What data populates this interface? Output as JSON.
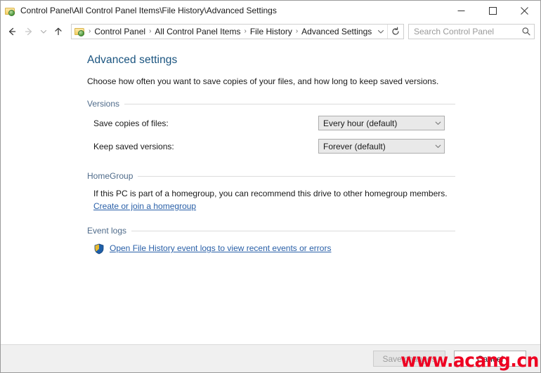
{
  "window": {
    "title": "Control Panel\\All Control Panel Items\\File History\\Advanced Settings",
    "icon": "control-panel-icon",
    "controls": {
      "minimize": "minimize-icon",
      "maximize": "maximize-icon",
      "close": "close-icon"
    }
  },
  "navbar": {
    "back": "back-arrow-icon",
    "forward": "forward-arrow-icon",
    "recent": "recent-locations-chevron-icon",
    "up": "up-arrow-icon",
    "address_icon": "control-panel-icon",
    "breadcrumbs": [
      {
        "label": "Control Panel"
      },
      {
        "label": "All Control Panel Items"
      },
      {
        "label": "File History"
      },
      {
        "label": "Advanced Settings"
      }
    ],
    "separator": "›",
    "dropdown_icon": "chevron-down-icon",
    "refresh_icon": "refresh-icon",
    "search": {
      "placeholder": "Search Control Panel",
      "value": "",
      "icon": "search-icon"
    }
  },
  "main": {
    "title": "Advanced settings",
    "description": "Choose how often you want to save copies of your files, and how long to keep saved versions.",
    "sections": {
      "versions": {
        "header": "Versions",
        "rows": [
          {
            "label": "Save copies of files:",
            "value": "Every hour (default)",
            "arrow_icon": "chevron-down-icon"
          },
          {
            "label": "Keep saved versions:",
            "value": "Forever (default)",
            "arrow_icon": "chevron-down-icon"
          }
        ]
      },
      "homegroup": {
        "header": "HomeGroup",
        "text": "If this PC is part of a homegroup, you can recommend this drive to other homegroup members.",
        "link": "Create or join a homegroup"
      },
      "event_logs": {
        "header": "Event logs",
        "shield_icon": "uac-shield-icon",
        "link": "Open File History event logs to view recent events or errors"
      }
    }
  },
  "footer": {
    "save_label": "Save changes",
    "cancel_label": "Cancel"
  },
  "watermark": {
    "text": "www.acang.cn"
  },
  "colors": {
    "title_blue": "#19537f",
    "link_blue": "#2a60a8",
    "group_header": "#4f6b8a",
    "watermark_red": "#ee0022",
    "combo_bg": "#e9e9e9",
    "footer_bg": "#f0f0f0"
  }
}
